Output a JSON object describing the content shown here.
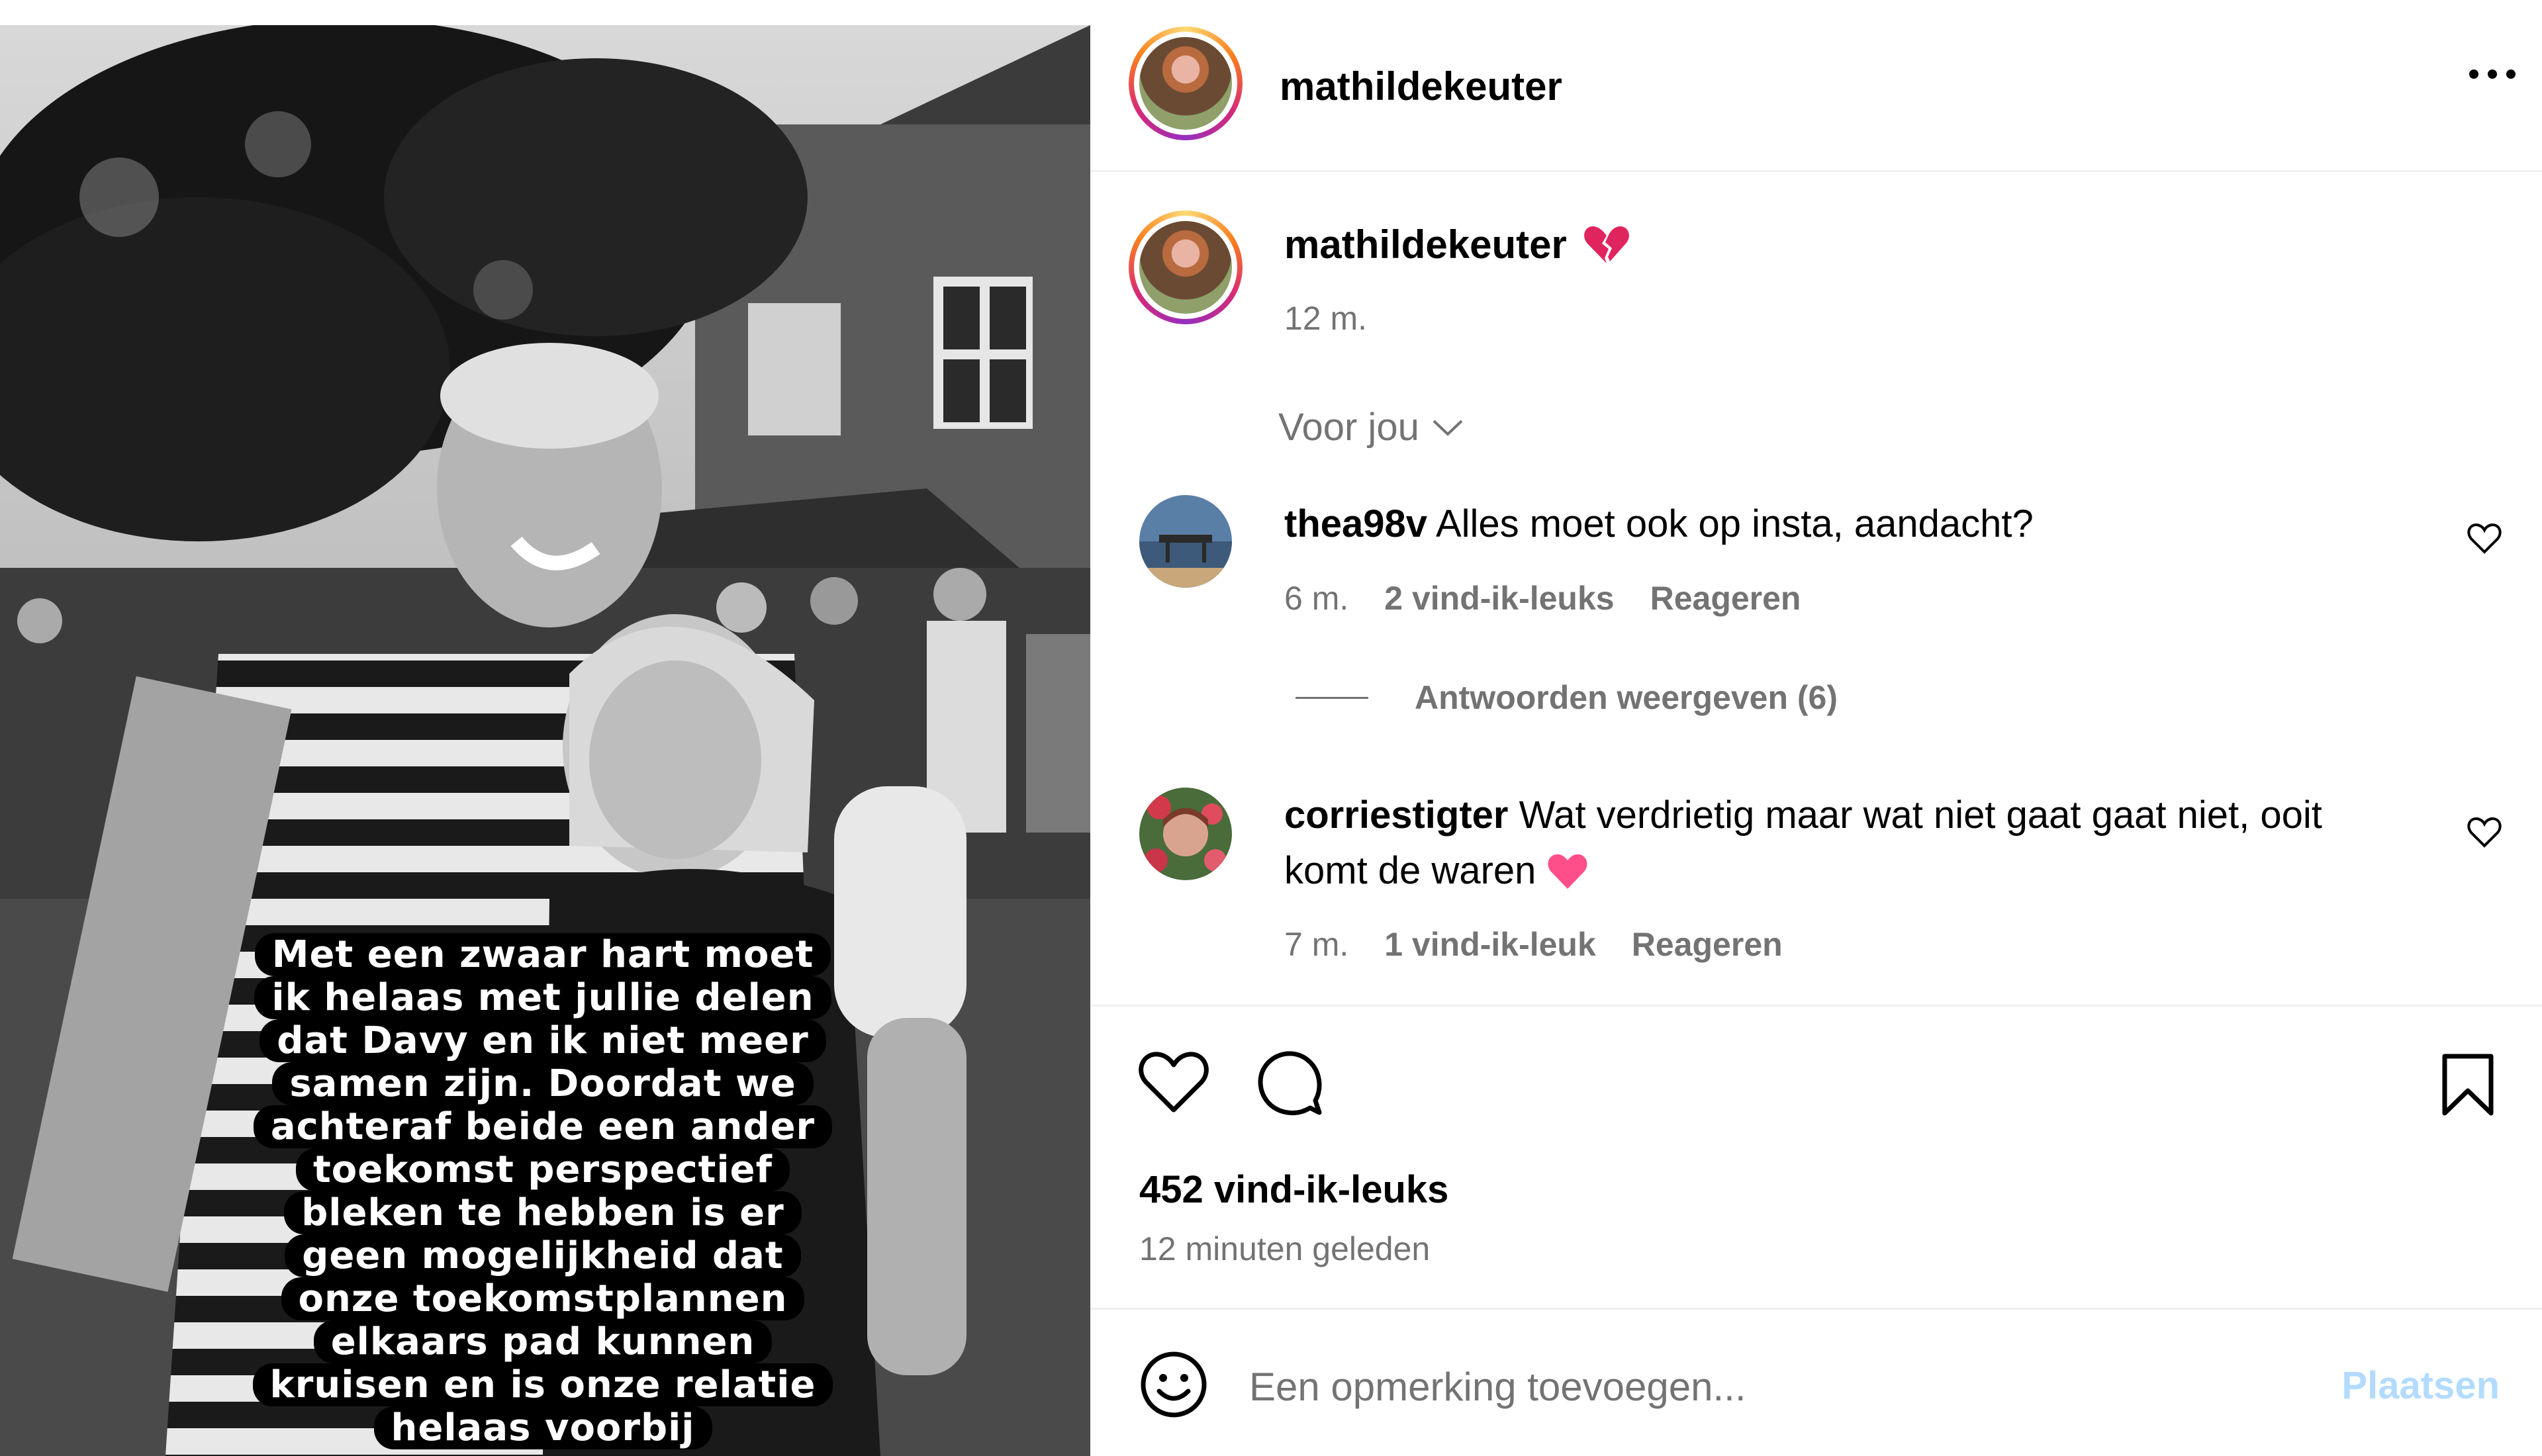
{
  "post": {
    "username": "mathildekeuter",
    "image_caption_lines": [
      "Met een zwaar hart moet",
      "ik helaas met jullie delen",
      "dat Davy en ik niet meer",
      "samen zijn. Doordat we",
      "achteraf beide een ander",
      "toekomst perspectief",
      "bleken te hebben is er",
      "geen mogelijkheid dat",
      "onze toekomstplannen",
      "elkaars pad kunnen",
      "kruisen en is onze relatie",
      "helaas voorbij"
    ]
  },
  "header": {
    "username": "mathildekeuter",
    "more_icon": "more-horizontal-icon"
  },
  "caption": {
    "username": "mathildekeuter",
    "emoji": "broken-heart-emoji",
    "time": "12 m."
  },
  "filter": {
    "label": "Voor jou"
  },
  "comments": [
    {
      "username": "thea98v",
      "text": "Alles moet ook op insta, aandacht?",
      "time": "6 m.",
      "likes": "2 vind-ik-leuks",
      "reply": "Reageren",
      "view_replies": "Antwoorden weergeven (6)"
    },
    {
      "username": "corriestigter",
      "text": "Wat verdrietig maar wat niet gaat gaat niet, ooit komt de waren",
      "emoji": "pink-heart-emoji",
      "time": "7 m.",
      "likes": "1 vind-ik-leuk",
      "reply": "Reageren"
    }
  ],
  "actions": {
    "like_icon": "heart-icon",
    "comment_icon": "comment-icon",
    "save_icon": "bookmark-icon"
  },
  "stats": {
    "likes": "452 vind-ik-leuks",
    "time": "12 minuten geleden"
  },
  "composer": {
    "placeholder": "Een opmerking toevoegen...",
    "post_label": "Plaatsen",
    "emoji_icon": "smiley-icon"
  },
  "colors": {
    "secondary_text": "#737373",
    "post_button_disabled": "#b3dbff",
    "broken_heart": "#e0245e",
    "pink_heart": "#ff4f8b"
  }
}
